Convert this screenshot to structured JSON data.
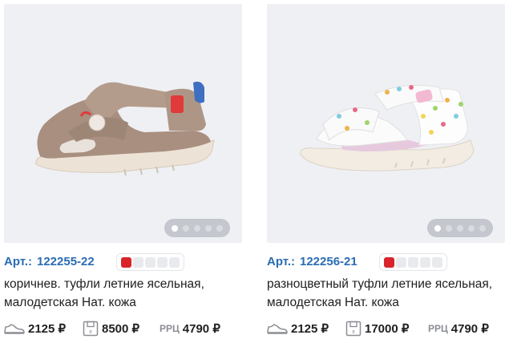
{
  "products": [
    {
      "art_label": "Арт.:",
      "art_number": "122255-22",
      "description_line1": "коричнев. туфли летние ясельная,",
      "description_line2": "малодетская Нат. кожа",
      "price_unit": "2125 ₽",
      "price_box": "8500 ₽",
      "rrc_label": "РРЦ",
      "price_rrc": "4790 ₽",
      "colors": [
        "#d8242a",
        "#e9eaee",
        "#e9eaee",
        "#e9eaee",
        "#e9eaee"
      ],
      "image_icon": "sandal-photo",
      "gallery_dots": 5,
      "gallery_active": 1
    },
    {
      "art_label": "Арт.:",
      "art_number": "122256-21",
      "description_line1": "разноцветный туфли летние ясельная,",
      "description_line2": "малодетская Нат. кожа",
      "price_unit": "2125 ₽",
      "price_box": "17000 ₽",
      "rrc_label": "РРЦ",
      "price_rrc": "4790 ₽",
      "colors": [
        "#d8242a",
        "#e9eaee",
        "#e9eaee",
        "#e9eaee",
        "#e9eaee"
      ],
      "image_icon": "sandal-photo",
      "gallery_dots": 5,
      "gallery_active": 1
    }
  ],
  "colors": {
    "accent": "#2a6cb3",
    "price_text": "#1f1f1f",
    "rrc_label": "#8a8d94",
    "photo_bg": "#eff0f4"
  }
}
